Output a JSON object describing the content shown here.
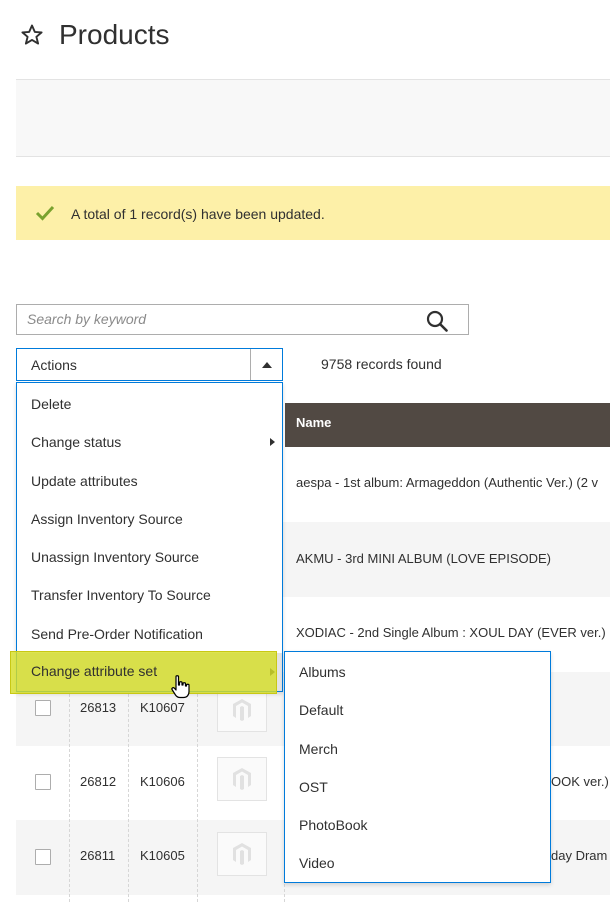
{
  "page": {
    "title": "Products"
  },
  "message": {
    "text": "A total of 1 record(s) have been updated."
  },
  "search": {
    "placeholder": "Search by keyword"
  },
  "actions": {
    "label": "Actions"
  },
  "records_found": "9758 records found",
  "grid": {
    "name_header": "Name",
    "rows": [
      {
        "name": "aespa - 1st album: Armageddon (Authentic Ver.) (2 v"
      },
      {
        "name": "AKMU - 3rd MINI ALBUM (LOVE EPISODE)"
      },
      {
        "name": "XODIAC - 2nd Single Album : XOUL DAY (EVER ver.)"
      },
      {
        "id": "26813",
        "sku": "K10607",
        "name_tail": ""
      },
      {
        "id": "26812",
        "sku": "K10606",
        "name_tail": "OOK ver.) ("
      },
      {
        "id": "26811",
        "sku": "K10605",
        "name_tail": "day Dram"
      }
    ]
  },
  "actions_menu": {
    "items": [
      "Delete",
      "Change status",
      "Update attributes",
      "Assign Inventory Source",
      "Unassign Inventory Source",
      "Transfer Inventory To Source",
      "Send Pre-Order Notification",
      "Change attribute set"
    ]
  },
  "attribute_set_submenu": {
    "items": [
      "Albums",
      "Default",
      "Merch",
      "OST",
      "PhotoBook",
      "Video"
    ]
  },
  "colors": {
    "header_bg": "#514943",
    "message_bg": "#fdf0a8",
    "focus_border": "#007bdb",
    "success_check": "#79a22e",
    "highlight": "#d6de28"
  },
  "icons": {
    "title": "star-icon",
    "message": "check-icon",
    "search": "search-icon",
    "cursor": "hand-cursor-icon",
    "thumbnail": "magento-placeholder-icon"
  }
}
